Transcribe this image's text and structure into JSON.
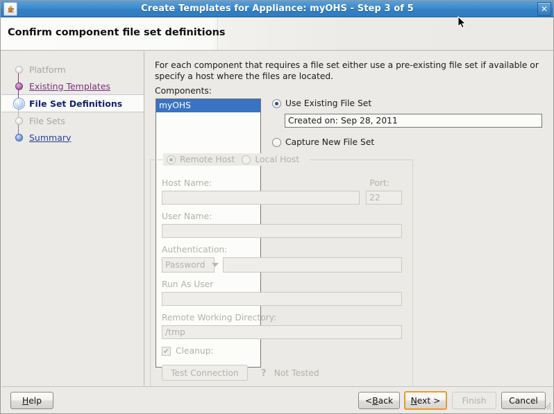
{
  "window": {
    "title": "Create Templates for Appliance: myOHS - Step 3 of 5",
    "app_icon": "java-coffee-cup-icon",
    "close_label": "✕"
  },
  "header": {
    "title": "Confirm component file set definitions"
  },
  "sidebar": {
    "steps": [
      {
        "label": "Platform",
        "state": "todo",
        "marker": "circle-empty-icon"
      },
      {
        "label": "Existing Templates",
        "state": "visited",
        "marker": "circle-filled-purple-icon"
      },
      {
        "label": "File Set Definitions",
        "state": "current",
        "marker": "circle-current-icon"
      },
      {
        "label": "File Sets",
        "state": "todo",
        "marker": "circle-empty-icon"
      },
      {
        "label": "Summary",
        "state": "link",
        "marker": "circle-filled-blue-icon"
      }
    ]
  },
  "main": {
    "intro": "For each component that requires a file set either use a pre-existing file set if available or specify a host where the files are located.",
    "components_label": "Components:",
    "components": [
      {
        "name": "myOHS",
        "selected": true
      }
    ],
    "file_set_mode": {
      "use_existing_label": "Use Existing File Set",
      "use_existing_selected": true,
      "existing_value": "Created on: Sep 28, 2011",
      "capture_new_label": "Capture New File Set",
      "capture_new_selected": false
    },
    "host_group": {
      "enabled": false,
      "remote_host_label": "Remote Host",
      "remote_host_selected": true,
      "local_host_label": "Local Host",
      "local_host_selected": false,
      "host_name_label": "Host Name:",
      "host_name_value": "",
      "port_label": "Port:",
      "port_value": "22",
      "user_name_label": "User Name:",
      "user_name_value": "",
      "authentication_label": "Authentication:",
      "authentication_value": "Password",
      "authentication_options": [
        "Password"
      ],
      "auth_secret_value": "",
      "run_as_user_label": "Run As User",
      "run_as_user_value": "",
      "remote_working_directory_label": "Remote Working Directory:",
      "remote_working_directory_value": "/tmp",
      "cleanup_label": "Cleanup:",
      "cleanup_checked": true,
      "cleanup_glyph": "✔",
      "test_connection_label": "Test Connection",
      "test_status_icon": "question-mark-icon",
      "test_status_label": "Not Tested"
    }
  },
  "footer": {
    "help_label": "Help",
    "help_mnemonic": "H",
    "back_label": "< Back",
    "back_mnemonic": "B",
    "next_label": "Next >",
    "next_mnemonic": "N",
    "next_focused": true,
    "finish_label": "Finish",
    "finish_enabled": false,
    "cancel_label": "Cancel"
  },
  "colors": {
    "titlebar_blue": "#3281c6",
    "selection_blue": "#3973c4",
    "focus_orange": "#e49b2c",
    "panel_gray": "#eceae6",
    "link_purple": "#7b2d7b",
    "link_blue": "#2340a0",
    "current_navy": "#12246e",
    "disabled_gray": "#b2b1aa"
  }
}
